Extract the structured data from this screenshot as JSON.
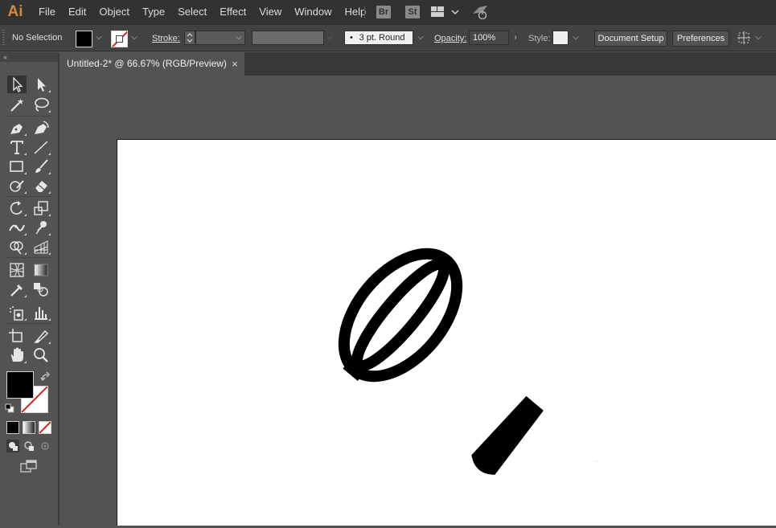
{
  "app": {
    "logo_text": "Ai",
    "accent_color": "#d18a3c"
  },
  "menu": {
    "items": [
      "File",
      "Edit",
      "Object",
      "Type",
      "Select",
      "Effect",
      "View",
      "Window",
      "Help"
    ]
  },
  "badges": {
    "bridge": "Br",
    "stock": "St"
  },
  "control_bar": {
    "selection_status": "No Selection",
    "fill_color": "#000000",
    "stroke_color": "none",
    "stroke_label": "Stroke:",
    "stroke_weight": "",
    "brush_label": "3 pt. Round",
    "opacity_label": "Opacity:",
    "opacity_value": "100%",
    "style_label": "Style:",
    "document_setup": "Document Setup",
    "preferences": "Preferences"
  },
  "document": {
    "tab_title": "Untitled-2* @ 66.67% (RGB/Preview)",
    "close_glyph": "×"
  },
  "tools": [
    "selection-tool",
    "direct-selection-tool",
    "magic-wand-tool",
    "lasso-tool",
    "pen-tool",
    "curvature-tool",
    "type-tool",
    "line-segment-tool",
    "rectangle-tool",
    "paintbrush-tool",
    "shaper-tool",
    "eraser-tool",
    "rotate-tool",
    "scale-tool",
    "width-tool",
    "puppet-warp-tool",
    "shape-builder-tool",
    "perspective-grid-tool",
    "mesh-tool",
    "gradient-tool",
    "eyedropper-tool",
    "blend-tool",
    "symbol-sprayer-tool",
    "column-graph-tool",
    "artboard-tool",
    "slice-tool",
    "hand-tool",
    "zoom-tool"
  ],
  "colors": {
    "fill": "#000000",
    "stroke": "none",
    "artboard": "#ffffff",
    "pasteboard": "#535353"
  },
  "artwork": {
    "subject": "whisk-icon",
    "color": "#000000"
  }
}
